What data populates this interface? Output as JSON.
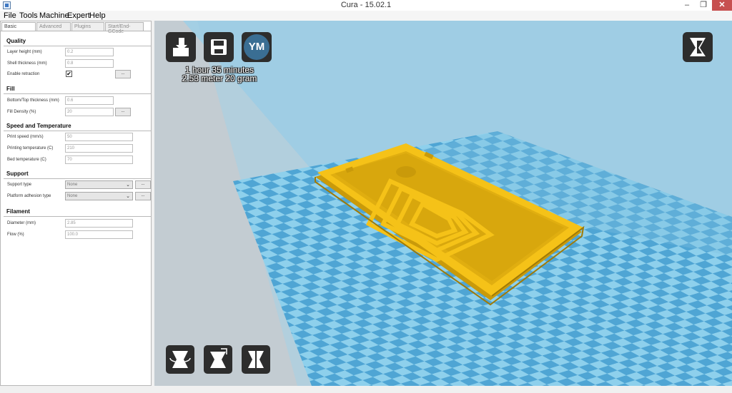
{
  "window": {
    "title": "Cura - 15.02.1",
    "close_glyph": "✕",
    "min_glyph": "–",
    "max_glyph": "❐"
  },
  "menu": [
    "File",
    "Tools",
    "Machine",
    "Expert",
    "Help"
  ],
  "tabs": [
    "Basic",
    "Advanced",
    "Plugins",
    "Start/End-GCode"
  ],
  "quality": {
    "title": "Quality",
    "layer_height": {
      "label": "Layer height (mm)",
      "value": "0.2"
    },
    "shell_thickness": {
      "label": "Shell thickness (mm)",
      "value": "0.8"
    },
    "enable_retraction": {
      "label": "Enable retraction",
      "checked": "✔"
    }
  },
  "fill": {
    "title": "Fill",
    "bottom_top": {
      "label": "Bottom/Top thickness (mm)",
      "value": "0.6"
    },
    "fill_density": {
      "label": "Fill Density (%)",
      "value": "20"
    }
  },
  "speed": {
    "title": "Speed and Temperature",
    "print_speed": {
      "label": "Print speed (mm/s)",
      "value": "50"
    },
    "printing_temp": {
      "label": "Printing temperature (C)",
      "value": "210"
    },
    "bed_temp": {
      "label": "Bed temperature (C)",
      "value": "70"
    }
  },
  "support": {
    "title": "Support",
    "support_type": {
      "label": "Support type",
      "value": "None"
    },
    "platform_adhesion": {
      "label": "Platform adhesion type",
      "value": "None"
    }
  },
  "filament": {
    "title": "Filament",
    "diameter": {
      "label": "Diameter (mm)",
      "value": "2.85"
    },
    "flow": {
      "label": "Flow (%)",
      "value": "100.0"
    }
  },
  "dots_label": "...",
  "viewport": {
    "print_time": "1 hour 35 minutes",
    "print_material": "2.53 meter 20 gram",
    "ym_label": "YM",
    "colors": {
      "model": "#f5c218",
      "model_shade": "#c99a0a",
      "bed_light": "#8ed0ec",
      "bed_dark": "#4fa5d4",
      "wall": "#9fcde4",
      "toolbar": "#2d2d2d"
    }
  }
}
